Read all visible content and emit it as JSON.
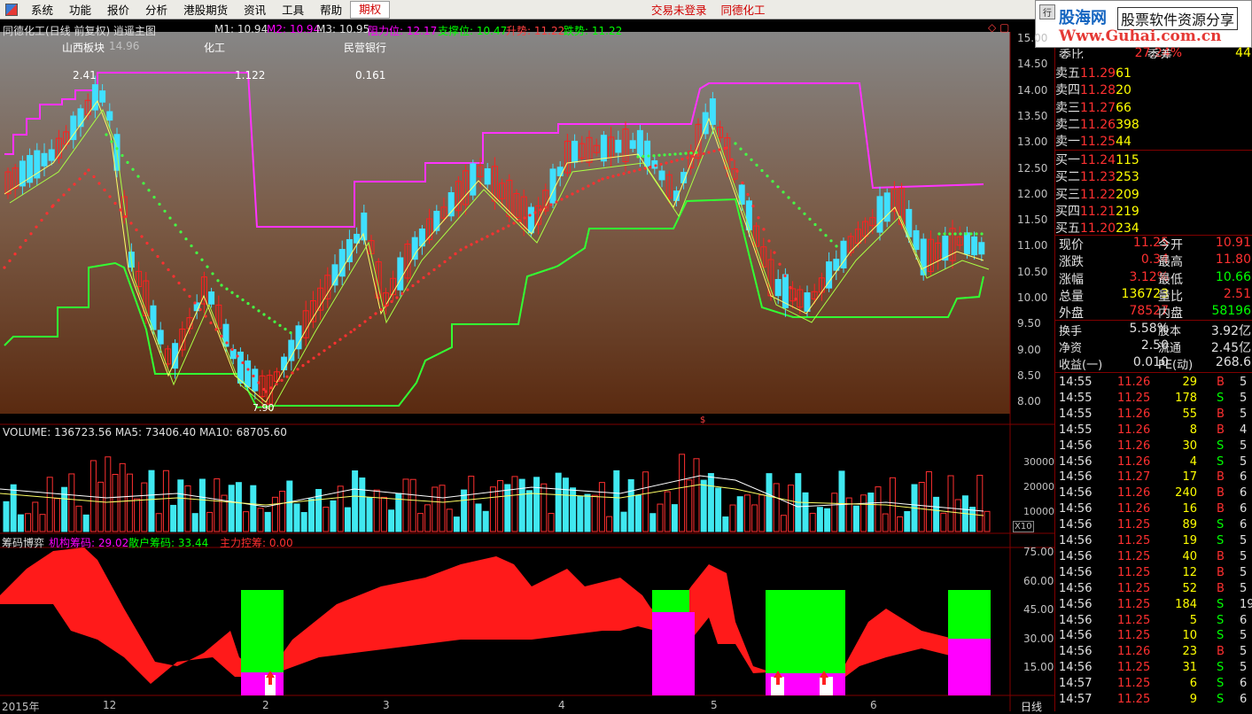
{
  "menu": {
    "items": [
      "系统",
      "功能",
      "报价",
      "分析",
      "港股期货",
      "资讯",
      "工具",
      "帮助",
      "期权"
    ],
    "status": "交易未登录",
    "stock_title": "同德化工"
  },
  "watermark": {
    "brand": "股海网",
    "slogan": "股票软件资源分享",
    "url": "Www.Guhai.com.cn",
    "button": "行"
  },
  "header": {
    "title": "同德化工(日线 前复权) 逍遥主图",
    "m1": "M1: 10.94",
    "m2": "M2: 10.94",
    "m3": "M3: 10.95",
    "resist": "阻力位: 12.17",
    "support": "支撑位: 10.47",
    "up": "升势: 11.22",
    "down": "跌势: 11.22"
  },
  "info": {
    "row1": [
      "山西板块",
      "14.96",
      "化工",
      "民营银行"
    ],
    "row2": [
      "2.41",
      "1.122",
      "0.161"
    ]
  },
  "price_axis": [
    "15.00",
    "14.50",
    "14.00",
    "13.50",
    "13.00",
    "12.50",
    "12.00",
    "11.50",
    "11.00",
    "10.50",
    "10.00",
    "9.50",
    "9.00",
    "8.50",
    "8.00"
  ],
  "low_label": "7.90",
  "volume": {
    "label": "VOLUME: 136723.56  MA5: 73406.40  MA10: 68705.60",
    "axis": [
      "30000",
      "20000",
      "10000"
    ],
    "unit": "X10"
  },
  "chip": {
    "title": "筹码博弈",
    "inst": "机构筹码: 29.02",
    "retail": "散户筹码: 33.44",
    "main": "主力控筹: 0.00",
    "axis": [
      "75.00",
      "60.00",
      "45.00",
      "30.00",
      "15.00"
    ]
  },
  "date_axis": [
    "2015年",
    "12",
    "2",
    "3",
    "4",
    "5",
    "6"
  ],
  "period": "日线",
  "quote": {
    "head": {
      "label": "委比",
      "pct": "27.24%",
      "label2": "委差",
      "value": "44"
    },
    "sell": [
      {
        "label": "卖五",
        "price": "11.29",
        "vol": "61"
      },
      {
        "label": "卖四",
        "price": "11.28",
        "vol": "20"
      },
      {
        "label": "卖三",
        "price": "11.27",
        "vol": "66"
      },
      {
        "label": "卖二",
        "price": "11.26",
        "vol": "398"
      },
      {
        "label": "卖一",
        "price": "11.25",
        "vol": "44"
      }
    ],
    "buy": [
      {
        "label": "买一",
        "price": "11.24",
        "vol": "115"
      },
      {
        "label": "买二",
        "price": "11.23",
        "vol": "253"
      },
      {
        "label": "买三",
        "price": "11.22",
        "vol": "209"
      },
      {
        "label": "买四",
        "price": "11.21",
        "vol": "219"
      },
      {
        "label": "买五",
        "price": "11.20",
        "vol": "234"
      }
    ],
    "stats": [
      [
        "现价",
        "11.25",
        "今开",
        "10.91"
      ],
      [
        "涨跌",
        "0.34",
        "最高",
        "11.80"
      ],
      [
        "涨幅",
        "3.12%",
        "最低",
        "10.66"
      ],
      [
        "总量",
        "136723",
        "量比",
        "2.51"
      ],
      [
        "外盘",
        "78527",
        "内盘",
        "58196"
      ]
    ],
    "stats2": [
      [
        "换手",
        "5.58%",
        "股本",
        "3.92亿"
      ],
      [
        "净资",
        "2.50",
        "流通",
        "2.45亿"
      ],
      [
        "收益(一)",
        "0.010",
        "PE(动)",
        "268.6"
      ]
    ],
    "ticks": [
      [
        "14:55",
        "11.26",
        "29",
        "B"
      ],
      [
        "14:55",
        "11.25",
        "178",
        "S"
      ],
      [
        "14:55",
        "11.26",
        "55",
        "B"
      ],
      [
        "14:55",
        "11.26",
        "8",
        "B"
      ],
      [
        "14:56",
        "11.26",
        "30",
        "S"
      ],
      [
        "14:56",
        "11.26",
        "4",
        "S"
      ],
      [
        "14:56",
        "11.27",
        "17",
        "B"
      ],
      [
        "14:56",
        "11.26",
        "240",
        "B"
      ],
      [
        "14:56",
        "11.26",
        "16",
        "B"
      ],
      [
        "14:56",
        "11.25",
        "89",
        "S"
      ],
      [
        "14:56",
        "11.25",
        "19",
        "S"
      ],
      [
        "14:56",
        "11.25",
        "40",
        "B"
      ],
      [
        "14:56",
        "11.25",
        "12",
        "B"
      ],
      [
        "14:56",
        "11.25",
        "52",
        "B"
      ],
      [
        "14:56",
        "11.25",
        "184",
        "S"
      ],
      [
        "14:56",
        "11.25",
        "5",
        "S"
      ],
      [
        "14:56",
        "11.25",
        "10",
        "S"
      ],
      [
        "14:56",
        "11.26",
        "23",
        "B"
      ],
      [
        "14:56",
        "11.25",
        "31",
        "S"
      ],
      [
        "14:57",
        "11.25",
        "6",
        "S"
      ],
      [
        "14:57",
        "11.25",
        "9",
        "S"
      ]
    ],
    "tick_last": [
      "5",
      "5",
      "5",
      "4",
      "5",
      "5",
      "6",
      "6",
      "6",
      "6",
      "5",
      "5",
      "5",
      "5",
      "19",
      "6",
      "5",
      "5",
      "5",
      "6",
      "6"
    ]
  }
}
